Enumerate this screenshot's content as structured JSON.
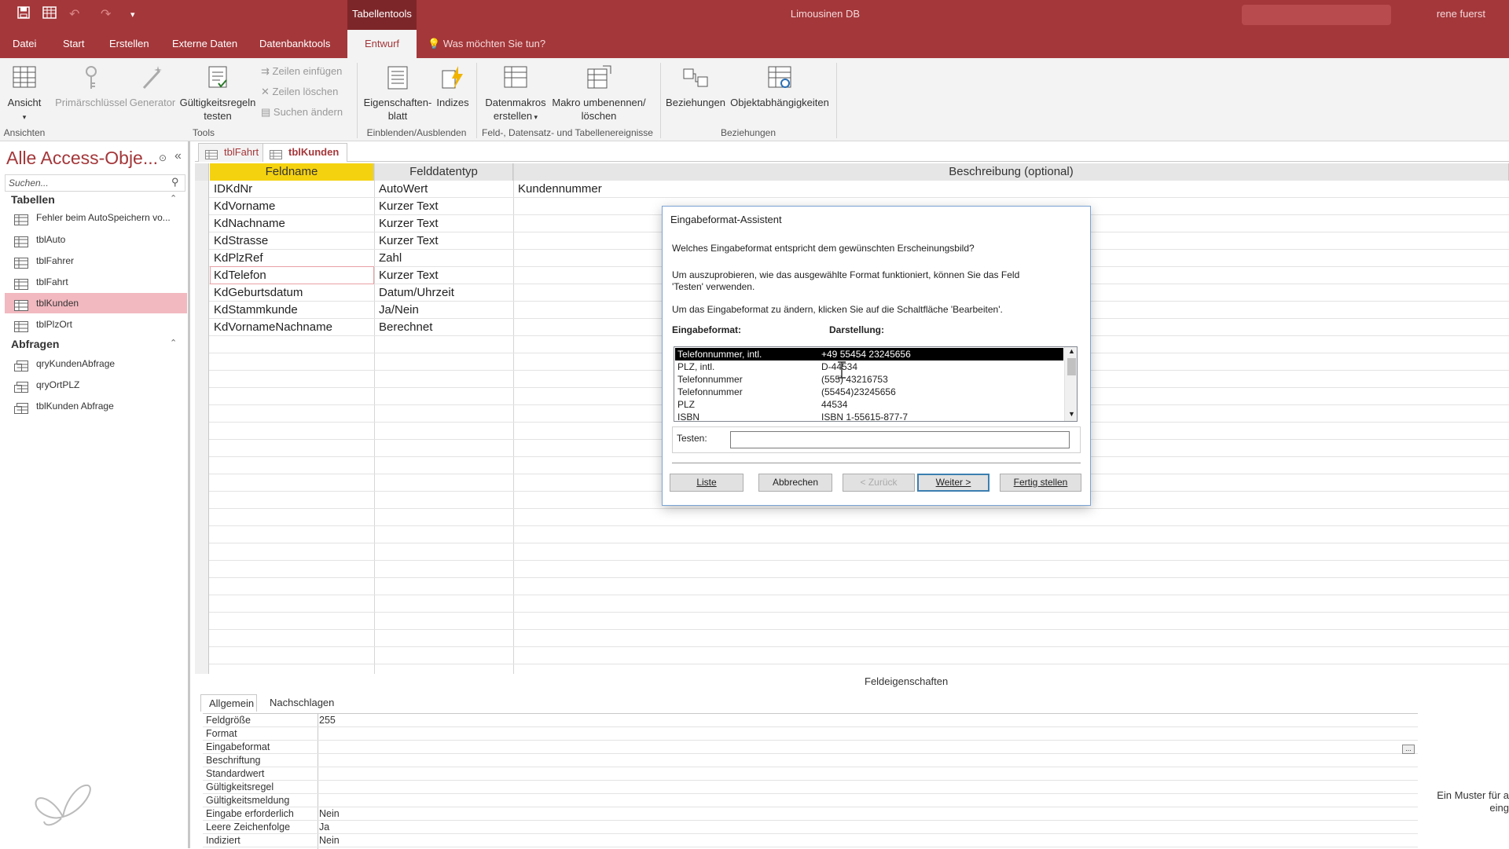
{
  "title_bar": {
    "context_label": "Tabellentools",
    "document_title": "Limousinen DB",
    "user": "rene fuerst"
  },
  "tabs": [
    "Datei",
    "Start",
    "Erstellen",
    "Externe Daten",
    "Datenbanktools",
    "Entwurf"
  ],
  "active_tab": "Entwurf",
  "tell_me": "Was möchten Sie tun?",
  "ribbon": {
    "ansicht": "Ansicht",
    "primaer": "Primärschlüssel",
    "generator": "Generator",
    "gueltig_1": "Gültigkeitsregeln",
    "gueltig_2": "testen",
    "zeilen_einfuegen": "Zeilen einfügen",
    "zeilen_loeschen": "Zeilen löschen",
    "suchen_aendern": "Suchen ändern",
    "eigenschaften_1": "Eigenschaften-",
    "eigenschaften_2": "blatt",
    "indizes": "Indizes",
    "datenmakros_1": "Datenmakros",
    "datenmakros_2": "erstellen",
    "makro_1": "Makro umbenennen/",
    "makro_2": "löschen",
    "beziehungen": "Beziehungen",
    "objektabh": "Objektabhängigkeiten",
    "groups": {
      "ansichten": "Ansichten",
      "tools": "Tools",
      "einblenden": "Einblenden/Ausblenden",
      "ereignisse": "Feld-, Datensatz- und Tabellenereignisse",
      "beziehungen": "Beziehungen"
    }
  },
  "nav": {
    "title": "Alle Access-Obje...",
    "search_placeholder": "Suchen...",
    "tables_header": "Tabellen",
    "tables": [
      "Fehler beim AutoSpeichern vo...",
      "tblAuto",
      "tblFahrer",
      "tblFahrt",
      "tblKunden",
      "tblPlzOrt"
    ],
    "selected_table": "tblKunden",
    "queries_header": "Abfragen",
    "queries": [
      "qryKundenAbfrage",
      "qryOrtPLZ",
      "tblKunden Abfrage"
    ]
  },
  "doc_tabs": [
    "tblFahrt",
    "tblKunden"
  ],
  "active_doc_tab": "tblKunden",
  "grid": {
    "headers": [
      "Feldname",
      "Felddatentyp",
      "Beschreibung (optional)"
    ],
    "rows": [
      {
        "name": "IDKdNr",
        "type": "AutoWert",
        "desc": "Kundennummer"
      },
      {
        "name": "KdVorname",
        "type": "Kurzer Text",
        "desc": ""
      },
      {
        "name": "KdNachname",
        "type": "Kurzer Text",
        "desc": ""
      },
      {
        "name": "KdStrasse",
        "type": "Kurzer Text",
        "desc": ""
      },
      {
        "name": "KdPlzRef",
        "type": "Zahl",
        "desc": ""
      },
      {
        "name": "KdTelefon",
        "type": "Kurzer Text",
        "desc": ""
      },
      {
        "name": "KdGeburtsdatum",
        "type": "Datum/Uhrzeit",
        "desc": ""
      },
      {
        "name": "KdStammkunde",
        "type": "Ja/Nein",
        "desc": ""
      },
      {
        "name": "KdVornameNachname",
        "type": "Berechnet",
        "desc": ""
      }
    ]
  },
  "properties": {
    "label": "Feldeigenschaften",
    "tabs": [
      "Allgemein",
      "Nachschlagen"
    ],
    "rows": [
      {
        "k": "Feldgröße",
        "v": "255"
      },
      {
        "k": "Format",
        "v": ""
      },
      {
        "k": "Eingabeformat",
        "v": ""
      },
      {
        "k": "Beschriftung",
        "v": ""
      },
      {
        "k": "Standardwert",
        "v": ""
      },
      {
        "k": "Gültigkeitsregel",
        "v": ""
      },
      {
        "k": "Gültigkeitsmeldung",
        "v": ""
      },
      {
        "k": "Eingabe erforderlich",
        "v": "Nein"
      },
      {
        "k": "Leere Zeichenfolge",
        "v": "Ja"
      },
      {
        "k": "Indiziert",
        "v": "Nein"
      }
    ],
    "help_1": "Ein Muster für a",
    "help_2": "eing"
  },
  "dialog": {
    "title": "Eingabeformat-Assistent",
    "question": "Welches Eingabeformat entspricht dem gewünschten Erscheinungsbild?",
    "hint_1": "Um auszuprobieren, wie das ausgewählte Format funktioniert, können Sie das Feld",
    "hint_2": "'Testen' verwenden.",
    "hint_3": "Um das Eingabeformat zu ändern, klicken Sie auf die Schaltfläche 'Bearbeiten'.",
    "col_format": "Eingabeformat:",
    "col_display": "Darstellung:",
    "formats": [
      {
        "name": "Telefonnummer, intl.",
        "display": "+49 55454 23245656"
      },
      {
        "name": "PLZ, intl.",
        "display": "D-44534"
      },
      {
        "name": "Telefonnummer",
        "display": "(555) 43216753"
      },
      {
        "name": "Telefonnummer",
        "display": "(55454)23245656"
      },
      {
        "name": "PLZ",
        "display": "44534"
      },
      {
        "name": "ISBN",
        "display": "ISBN 1-55615-877-7"
      }
    ],
    "selected_index": 0,
    "test_label": "Testen:",
    "test_value": "",
    "buttons": {
      "liste": "Liste",
      "abbrechen": "Abbrechen",
      "zurueck": "< Zurück",
      "weiter": "Weiter >",
      "fertig": "Fertig stellen"
    }
  },
  "colors": {
    "accent": "#a4373a",
    "context_tab": "#7d2629",
    "nav_selected": "#f2b9c0",
    "field_name_header": "#f5d20f",
    "row_marker": "#f5d20f"
  }
}
